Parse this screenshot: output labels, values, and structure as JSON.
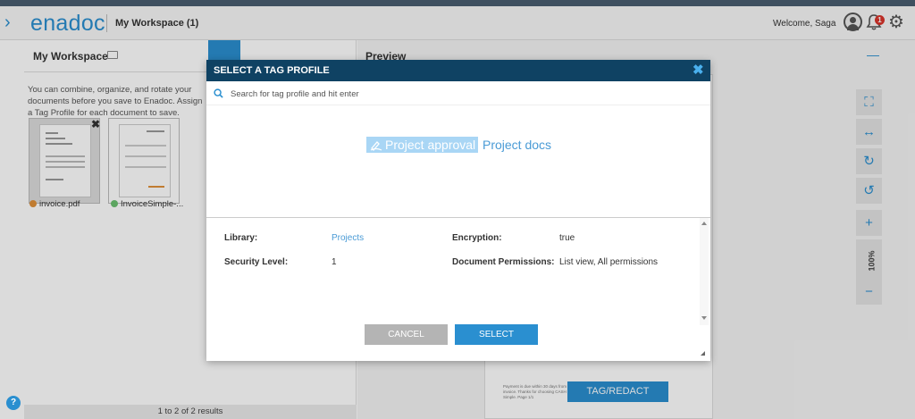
{
  "app": {
    "logo_text": "enadoc",
    "workspace_title": "My Workspace (1)",
    "welcome_text": "Welcome,  Saga",
    "notification_count": "1"
  },
  "left_panel": {
    "title": "My Workspace",
    "description": "You can combine, organize, and rotate your documents before you save to Enadoc. Assign a Tag Profile for each document to save.",
    "documents": [
      {
        "name": "invoice.pdf",
        "status_color": "#e0913a",
        "selected": true
      },
      {
        "name": "InvoiceSimple-...",
        "status_color": "#6cc070",
        "selected": false
      }
    ],
    "pagination": "1 to 2 of  2  results"
  },
  "right_panel": {
    "title": "Preview",
    "fine_print": "Payment is due within 30 days from date of invoice. Thanks for choosing CASH - Invoice Simple. Page 1/1",
    "tag_redact_label": "TAG/REDACT",
    "zoom_level": "100%"
  },
  "modal": {
    "title": "SELECT A TAG PROFILE",
    "search_placeholder": "Search for tag profile and hit enter",
    "profiles": [
      {
        "label": "Project approval",
        "active": true
      },
      {
        "label": "Project docs",
        "active": false
      }
    ],
    "details": {
      "library_label": "Library:",
      "library_value": "Projects",
      "security_label": "Security Level:",
      "security_value": "1",
      "encryption_label": "Encryption:",
      "encryption_value": "true",
      "permissions_label": "Document Permissions:",
      "permissions_value": "List view, All permissions"
    },
    "cancel_label": "CANCEL",
    "select_label": "SELECT"
  },
  "colors": {
    "accent": "#2a8fd0",
    "modal_header": "#0f4263",
    "active_chip": "#a9d6f5"
  }
}
